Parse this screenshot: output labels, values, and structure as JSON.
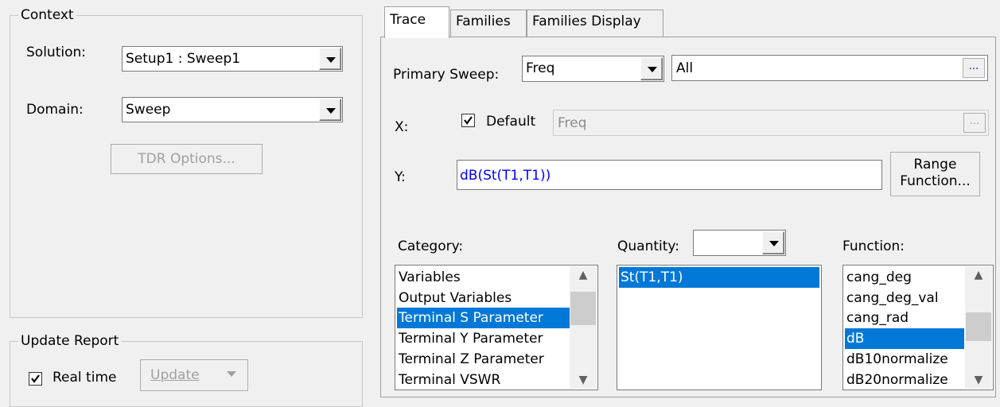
{
  "context": {
    "legend": "Context",
    "solution_label": "Solution:",
    "solution_value": "Setup1 : Sweep1",
    "domain_label": "Domain:",
    "domain_value": "Sweep",
    "tdr_button": "TDR Options..."
  },
  "update_report": {
    "legend": "Update Report",
    "realtime_label": "Real time",
    "realtime_checked": true,
    "update_button": "Update"
  },
  "tabs": [
    {
      "label": "Trace",
      "active": true
    },
    {
      "label": "Families",
      "active": false
    },
    {
      "label": "Families Display",
      "active": false
    }
  ],
  "trace": {
    "primary_sweep_label": "Primary Sweep:",
    "primary_sweep_value": "Freq",
    "primary_sweep_range": "All",
    "ellipsis": "...",
    "x_label": "X:",
    "x_default_label": "Default",
    "x_default_checked": true,
    "x_value": "Freq",
    "y_label": "Y:",
    "y_value": "dB(St(T1,T1))",
    "range_function_line1": "Range",
    "range_function_line2": "Function..."
  },
  "category": {
    "label": "Category:",
    "items": [
      "Variables",
      "Output Variables",
      "Terminal S Parameter",
      "Terminal Y Parameter",
      "Terminal Z Parameter",
      "Terminal VSWR"
    ],
    "selected_index": 2
  },
  "quantity": {
    "label": "Quantity:",
    "filter_value": "",
    "items": [
      "St(T1,T1)"
    ],
    "selected_index": 0
  },
  "function": {
    "label": "Function:",
    "items": [
      "cang_deg",
      "cang_deg_val",
      "cang_rad",
      "dB",
      "dB10normalize",
      "dB20normalize"
    ],
    "selected_index": 3
  },
  "colors": {
    "selection": "#0078d7",
    "expression_text": "#0000ff",
    "panel_bg": "#f0f0f0"
  }
}
